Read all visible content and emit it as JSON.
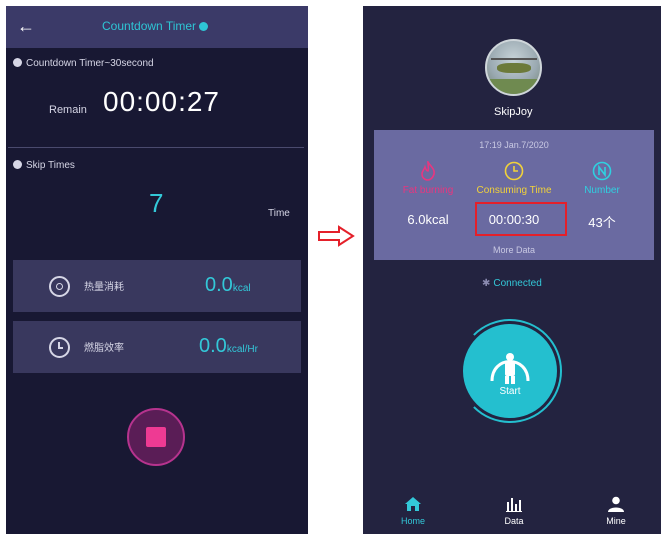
{
  "left": {
    "header": {
      "title": "Countdown Timer"
    },
    "countdown": {
      "label": "Countdown Timer~30second",
      "remain_label": "Remain",
      "time": "00:00:27"
    },
    "skip": {
      "label": "Skip Times",
      "count": "7",
      "unit": "Time"
    },
    "cards": [
      {
        "label": "热量消耗",
        "value": "0.0",
        "unit": "kcal",
        "icon": "scale-icon"
      },
      {
        "label": "燃脂效率",
        "value": "0.0",
        "unit": "kcal/Hr",
        "icon": "clock-icon"
      }
    ]
  },
  "right": {
    "user": {
      "name": "SkipJoy"
    },
    "stats": {
      "date": "17:19 Jan.7/2020",
      "columns": [
        {
          "label": "Fat burning",
          "value": "6.0kcal",
          "color": "#e8367f",
          "icon": "flame-icon"
        },
        {
          "label": "Consuming Time",
          "value": "00:00:30",
          "color": "#f1d23a",
          "icon": "clock-icon"
        },
        {
          "label": "Number",
          "value": "43个",
          "color": "#2fd0e0",
          "icon": "number-n-icon"
        }
      ],
      "more": "More Data"
    },
    "connection": "Connected",
    "start_label": "Start",
    "nav": [
      {
        "label": "Home",
        "active": true,
        "icon": "home-icon"
      },
      {
        "label": "Data",
        "active": false,
        "icon": "bar-chart-icon"
      },
      {
        "label": "Mine",
        "active": false,
        "icon": "person-icon"
      }
    ]
  },
  "colors": {
    "accent": "#33c8d8",
    "stop": "#ee3a93",
    "highlight": "#e4202a",
    "arrow": "#e4202a"
  }
}
